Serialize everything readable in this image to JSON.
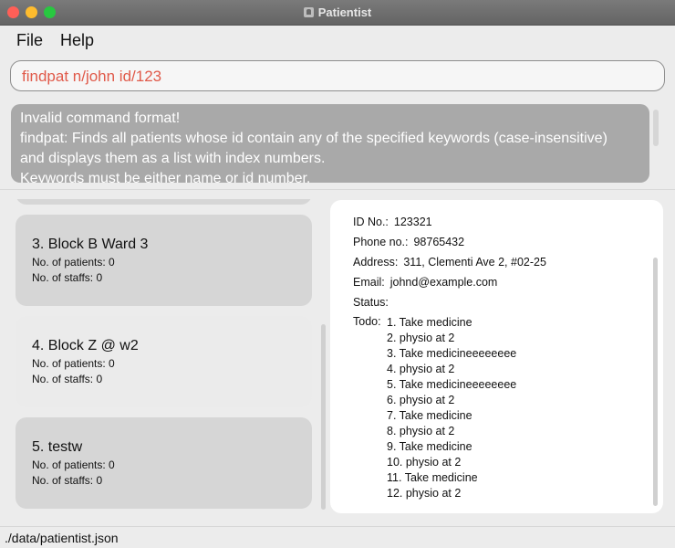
{
  "window": {
    "title": "Patientist",
    "app_icon": "patientist-app-icon"
  },
  "menu": {
    "file_label": "File",
    "help_label": "Help"
  },
  "command": {
    "value": "findpat n/john id/123"
  },
  "result": {
    "lines": [
      "Invalid command format!",
      "findpat: Finds all patients whose id contain any of the specified keywords (case-insensitive)",
      "and displays them as a list with index numbers.",
      "Keywords must be either name or id number."
    ]
  },
  "wards": [
    {
      "title": "3.  Block B Ward 3",
      "patients": "No. of patients: 0",
      "staffs": "No. of staffs: 0"
    },
    {
      "title": "4.  Block Z @ w2",
      "patients": "No. of patients: 0",
      "staffs": "No. of staffs: 0"
    },
    {
      "title": "5.  testw",
      "patients": "No. of patients: 0",
      "staffs": "No. of staffs: 0"
    }
  ],
  "details": {
    "id": {
      "label": "ID No.:",
      "value": "123321"
    },
    "phone": {
      "label": "Phone no.:",
      "value": "98765432"
    },
    "address": {
      "label": "Address:",
      "value": "311, Clementi Ave 2, #02-25"
    },
    "email": {
      "label": "Email:",
      "value": "johnd@example.com"
    },
    "status": {
      "label": "Status:",
      "value": ""
    },
    "todo_label": "Todo:",
    "todos": [
      "1. Take medicine",
      "2. physio at 2",
      "3. Take medicineeeeeeee",
      "4. physio at 2",
      "5. Take medicineeeeeeee",
      "6. physio at 2",
      "7. Take medicine",
      "8. physio at 2",
      "9. Take medicine",
      "10. physio at 2",
      "11. Take medicine",
      "12. physio at 2"
    ]
  },
  "status_bar": {
    "path": "./data/patientist.json"
  },
  "colors": {
    "command_text": "#e05a4a",
    "result_bg": "#a9a9a9",
    "card_bg": "#d6d6d6",
    "card_alt_bg": "#ebebeb"
  }
}
